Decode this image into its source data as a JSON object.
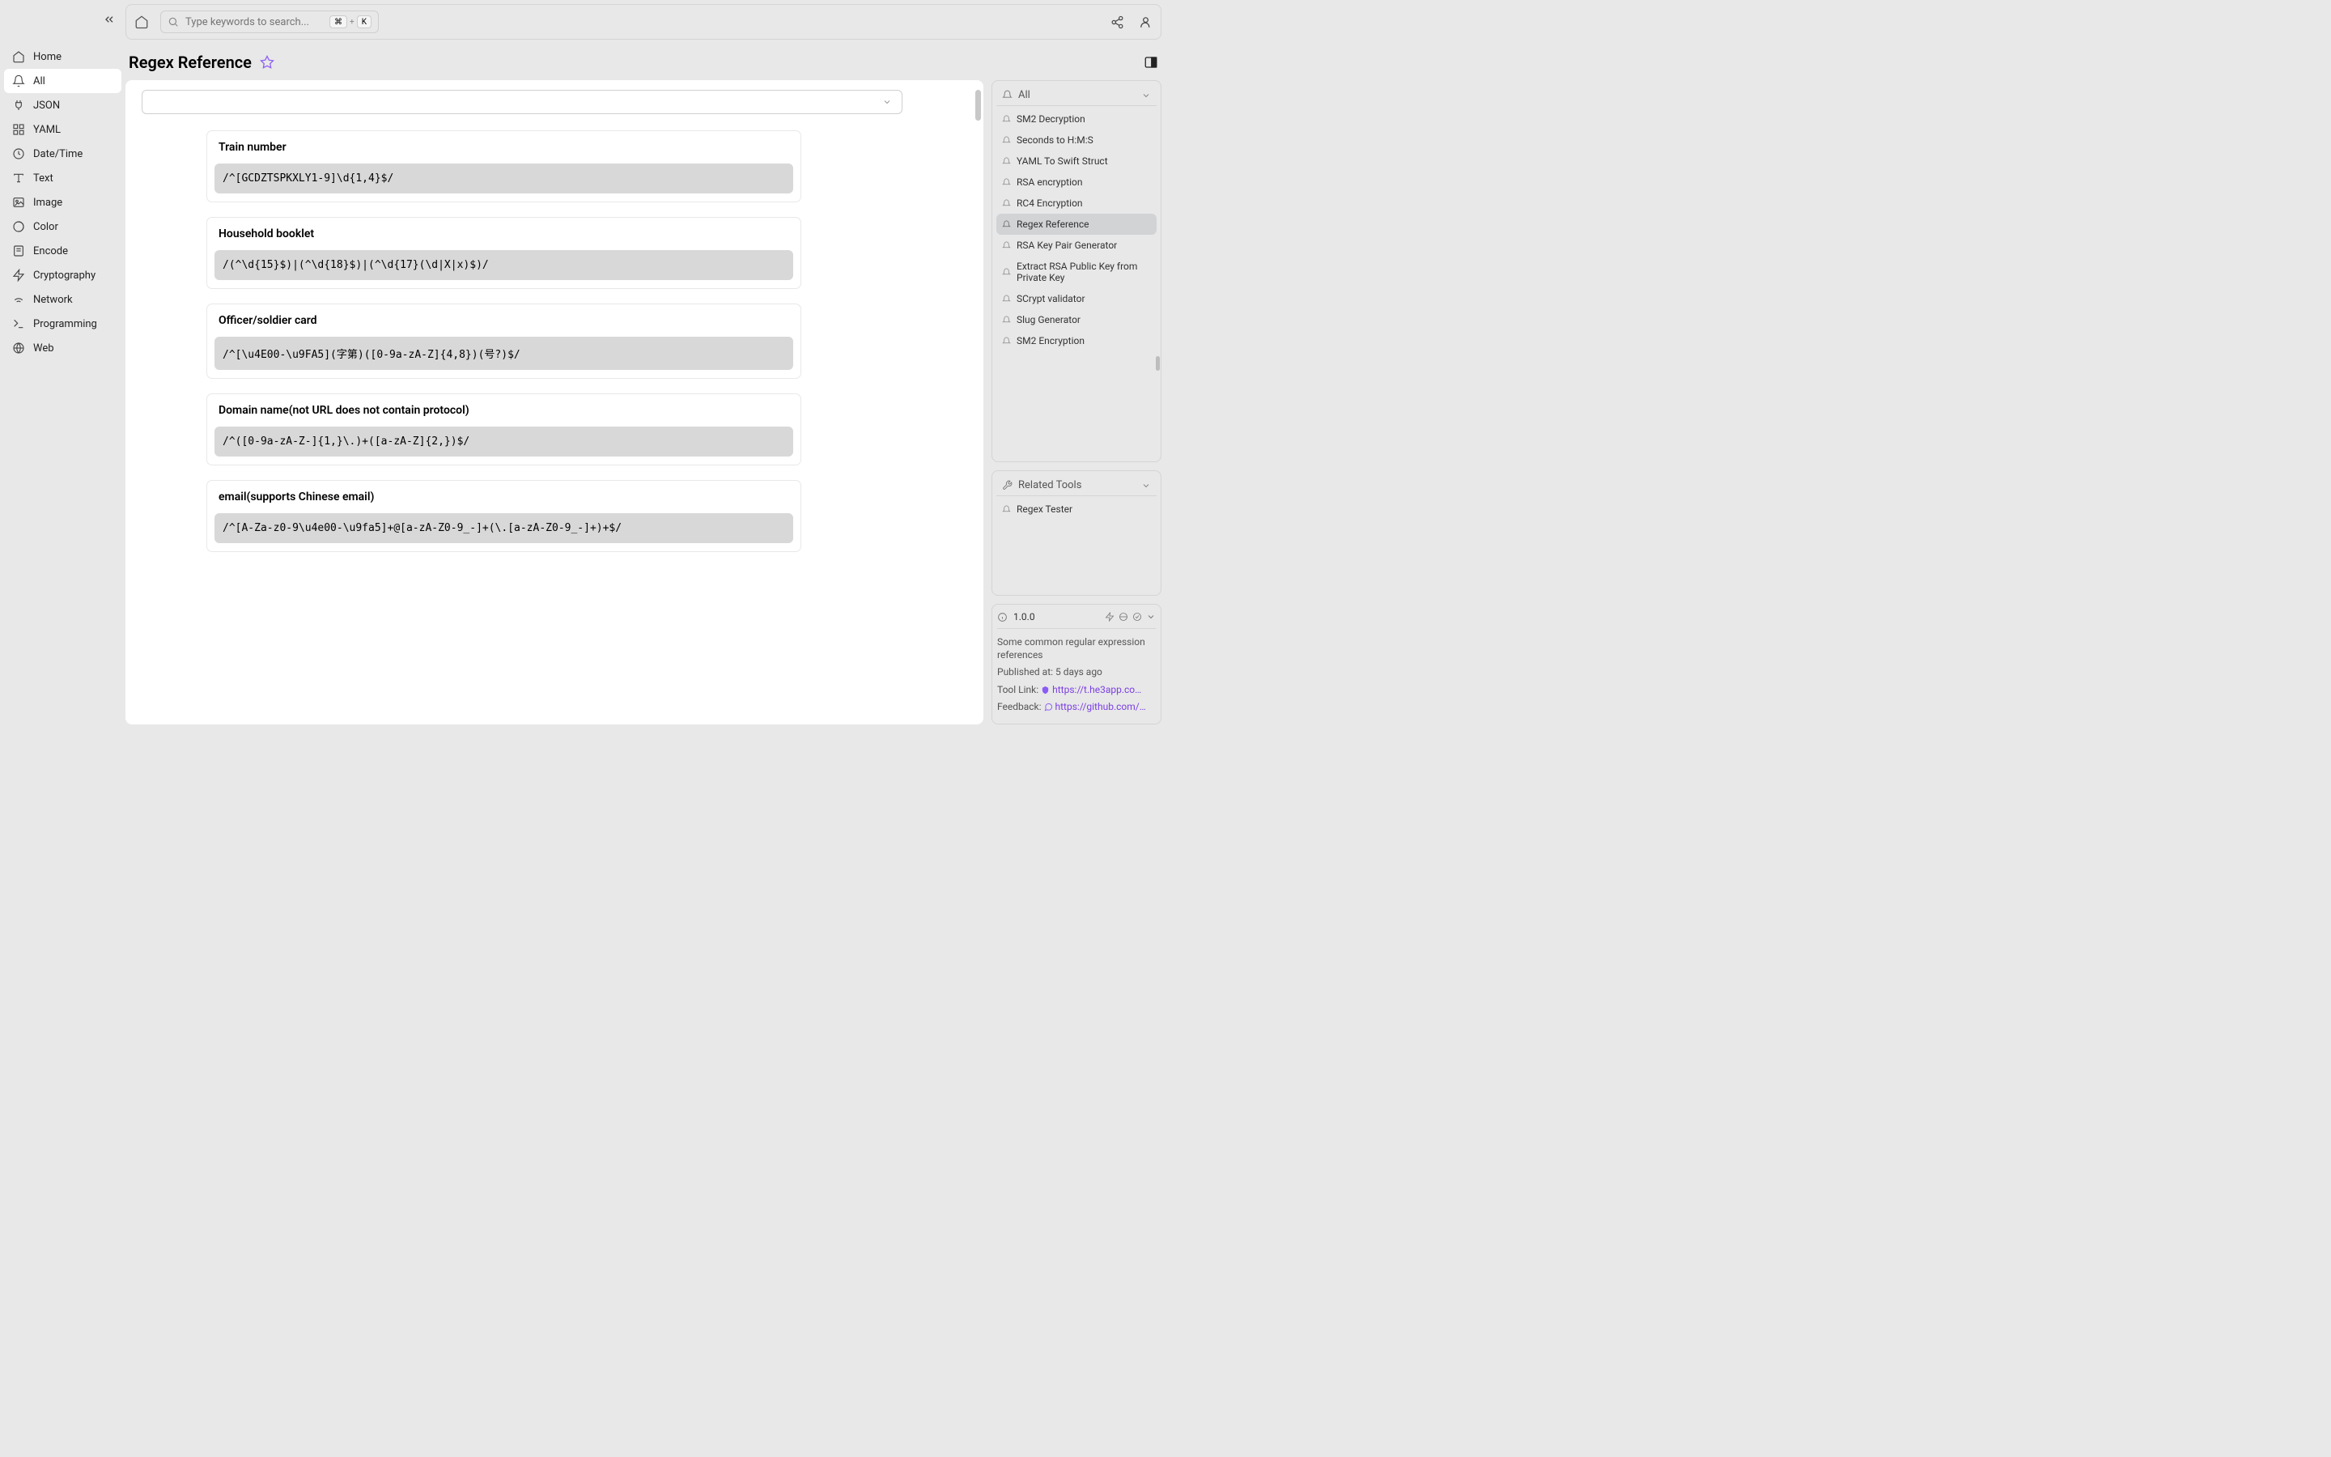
{
  "search": {
    "placeholder": "Type keywords to search...",
    "kbd1": "⌘",
    "plus": "+",
    "kbd2": "K"
  },
  "sidebar": {
    "items": [
      {
        "label": "Home"
      },
      {
        "label": "All"
      },
      {
        "label": "JSON"
      },
      {
        "label": "YAML"
      },
      {
        "label": "Date/Time"
      },
      {
        "label": "Text"
      },
      {
        "label": "Image"
      },
      {
        "label": "Color"
      },
      {
        "label": "Encode"
      },
      {
        "label": "Cryptography"
      },
      {
        "label": "Network"
      },
      {
        "label": "Programming"
      },
      {
        "label": "Web"
      }
    ]
  },
  "page": {
    "title": "Regex Reference"
  },
  "regex_items": [
    {
      "title": "Train number",
      "pattern": "/^[GCDZTSPKXLY1-9]\\d{1,4}$/"
    },
    {
      "title": "Household booklet",
      "pattern": "/(^\\d{15}$)|(^\\d{18}$)|(^\\d{17}(\\d|X|x)$)/"
    },
    {
      "title": "Officer/soldier card",
      "pattern": "/^[\\u4E00-\\u9FA5](字第)([0-9a-zA-Z]{4,8})(号?)$/"
    },
    {
      "title": "Domain name(not URL does not contain protocol)",
      "pattern": "/^([0-9a-zA-Z-]{1,}\\.)+([a-zA-Z]{2,})$/"
    },
    {
      "title": "email(supports Chinese email)",
      "pattern": "/^[A-Za-z0-9\\u4e00-\\u9fa5]+@[a-zA-Z0-9_-]+(\\.[a-zA-Z0-9_-]+)+$/"
    }
  ],
  "right": {
    "all_label": "All",
    "tools": [
      {
        "label": "SM2 Decryption"
      },
      {
        "label": "Seconds to H:M:S"
      },
      {
        "label": "YAML To Swift Struct"
      },
      {
        "label": "RSA encryption"
      },
      {
        "label": "RC4 Encryption"
      },
      {
        "label": "Regex Reference"
      },
      {
        "label": "RSA Key Pair Generator"
      },
      {
        "label": "Extract RSA Public Key from Private Key"
      },
      {
        "label": "SCrypt validator"
      },
      {
        "label": "Slug Generator"
      },
      {
        "label": "SM2 Encryption"
      }
    ],
    "related_label": "Related Tools",
    "related_items": [
      {
        "label": "Regex Tester"
      }
    ]
  },
  "info": {
    "version": "1.0.0",
    "desc": "Some common regular expression references",
    "published_label": "Published at:",
    "published_value": "5 days ago",
    "tool_link_label": "Tool Link:",
    "tool_link_value": "https://t.he3app.co…",
    "feedback_label": "Feedback:",
    "feedback_value": "https://github.com/…"
  }
}
